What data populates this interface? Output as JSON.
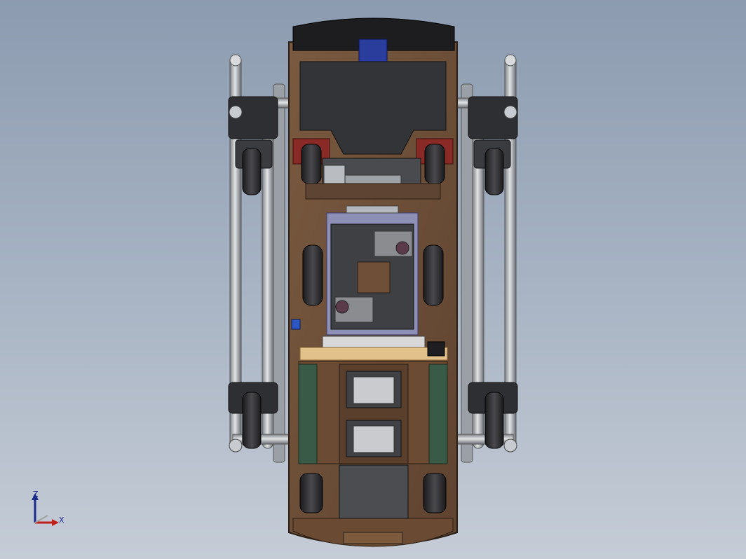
{
  "viewport": {
    "background_top": "#8c9bb0",
    "background_bottom": "#c5ccd6",
    "accent_wood": "#6e4e36",
    "accent_metal": "#bfc3c7"
  },
  "triad": {
    "z_label": "Z",
    "x_label": "X",
    "z_color": "#1a2a8a",
    "x_color": "#c0201a"
  }
}
